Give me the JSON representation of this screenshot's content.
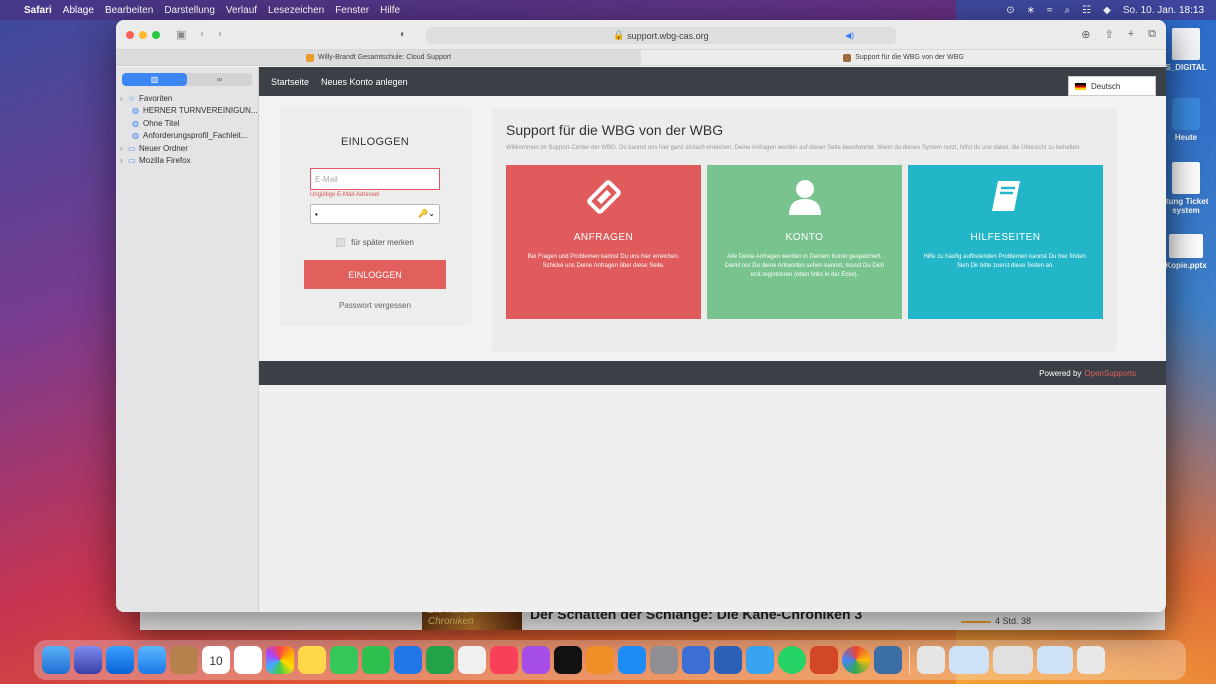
{
  "menubar": {
    "app": "Safari",
    "items": [
      "Ablage",
      "Bearbeiten",
      "Darstellung",
      "Verlauf",
      "Lesezeichen",
      "Fenster",
      "Hilfe"
    ],
    "datetime": "So. 10. Jan. 18:13"
  },
  "background_window": {
    "book_title": "Der Schatten der Schlange: Die Kane-Chroniken 3",
    "cover_text": "Die Kane-Chroniken",
    "time_left": "4 Std. 38"
  },
  "desktop_icons": [
    {
      "label": "S_DIGITAL"
    },
    {
      "label": "Heute"
    },
    {
      "label": "itung Ticket system"
    },
    {
      "label": "Kopie.pptx"
    }
  ],
  "browser": {
    "url": "support.wbg-cas.org",
    "tabs": [
      {
        "label": "Willy-Brandt Gesamtschule: Cloud Support",
        "active": false
      },
      {
        "label": "Support für die WBG von der WBG",
        "active": true
      }
    ]
  },
  "sidebar": {
    "seg_left": "▥",
    "seg_right": "∞",
    "items": [
      {
        "label": "Favoriten",
        "icon": "☆",
        "type": "group"
      },
      {
        "label": "HERNER TURNVEREINIGUN...",
        "icon": "🌐",
        "type": "sub"
      },
      {
        "label": "Ohne Titel",
        "icon": "🌐",
        "type": "sub"
      },
      {
        "label": "Anforderungsprofil_Fachleit...",
        "icon": "🌐",
        "type": "sub"
      },
      {
        "label": "Neuer Ordner",
        "icon": "▭",
        "type": "group"
      },
      {
        "label": "Mozilla Firefox",
        "icon": "▭",
        "type": "group"
      }
    ]
  },
  "nav": {
    "home": "Startseite",
    "new_account": "Neues Konto anlegen",
    "language": "Deutsch"
  },
  "login": {
    "title": "EINLOGGEN",
    "email_placeholder": "E-Mail",
    "email_error": "Ungültige E-Mail-Adresse!",
    "password_value": "•",
    "remember": "für später merken",
    "button": "EINLOGGEN",
    "forgot": "Passwort vergessen"
  },
  "main": {
    "title": "Support für die WBG von der WBG",
    "intro": "Willkommen im Support-Center der WBG. Du kannst uns hier ganz einfach erreichen. Deine Anfragen werden auf dieser Seite beantwortet. Wenn du dieses System nutzt, hilfst du uns dabei, die Übersicht zu behalten.",
    "cards": [
      {
        "title": "ANFRAGEN",
        "text": "Bei Fragen und Problemen kannst Du uns hier erreichen. Schicke uns Deine Anfragen über diese Seite."
      },
      {
        "title": "KONTO",
        "text": "Alle Deine Anfragen werden in Deinem Konto gespeichert. Damit nur Du deine Antworten sehen kannst, musst Du Dich erst registrieren (oben links in der Ecke)."
      },
      {
        "title": "HILFESEITEN",
        "text": "Hilfe zu häufig auftretenden Problemen kannst Du hier finden. Sieh Dir bitte zuerst diese Seiten an."
      }
    ]
  },
  "footer": {
    "powered_by": "Powered by",
    "brand": "OpenSupports"
  },
  "dock": {
    "calendar_month": "JAN",
    "calendar_day": "10"
  }
}
